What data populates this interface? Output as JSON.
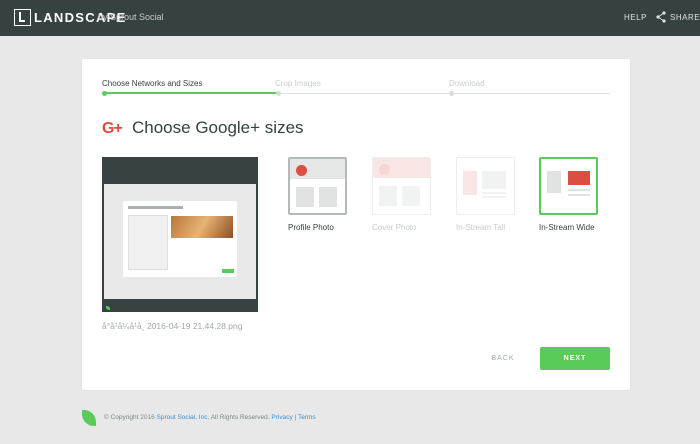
{
  "header": {
    "logo_text": "LANDSCAPE",
    "logo_by": "by Sprout Social",
    "help": "HELP",
    "share": "SHARE"
  },
  "steps": [
    {
      "label": "Choose Networks and Sizes",
      "active": true
    },
    {
      "label": "Crop Images",
      "active": false
    },
    {
      "label": "Download",
      "active": false
    }
  ],
  "title": {
    "icon": "G+",
    "text": "Choose Google+ sizes"
  },
  "filename": "å°å¹å¼å¹å¸ 2016-04-19 21.44.28.png",
  "options": [
    {
      "label": "Profile Photo",
      "state": "selected"
    },
    {
      "label": "Cover Photo",
      "state": "disabled"
    },
    {
      "label": "In-Stream Tall",
      "state": "disabled"
    },
    {
      "label": "In-Stream Wide",
      "state": "selected"
    }
  ],
  "buttons": {
    "back": "BACK",
    "next": "NEXT"
  },
  "footer": {
    "copyright": "© Copyright 2016",
    "company": "Sprout Social, Inc.",
    "rights": "All Rights Reserved.",
    "privacy": "Privacy",
    "separator": "|",
    "terms": "Terms"
  },
  "colors": {
    "header_bg": "#364141",
    "accent_green": "#59cb59",
    "google_red": "#dc4e41",
    "link_blue": "#3c8fcc"
  }
}
